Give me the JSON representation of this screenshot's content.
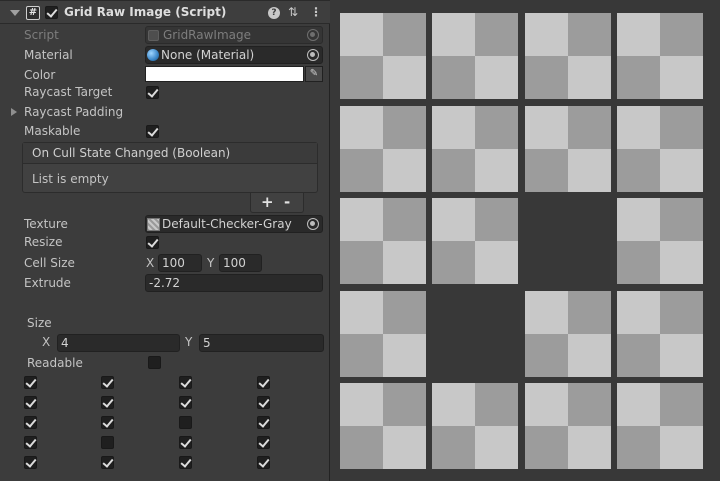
{
  "component": {
    "title": "Grid Raw Image (Script)",
    "enabled": true,
    "script_icon": "#",
    "header_icons": [
      "help-icon",
      "presets-icon",
      "kebab-menu-icon"
    ]
  },
  "fields": {
    "script": {
      "label": "Script",
      "value": "GridRawImage"
    },
    "material": {
      "label": "Material",
      "value": "None (Material)"
    },
    "color": {
      "label": "Color",
      "value": "#ffffff"
    },
    "raycast_target": {
      "label": "Raycast Target",
      "checked": true
    },
    "raycast_padding": {
      "label": "Raycast Padding"
    },
    "maskable": {
      "label": "Maskable",
      "checked": true
    },
    "texture": {
      "label": "Texture",
      "value": "Default-Checker-Gray"
    },
    "resize": {
      "label": "Resize",
      "checked": true
    },
    "cell_size": {
      "label": "Cell Size",
      "x_label": "X",
      "x": "100",
      "y_label": "Y",
      "y": "100"
    },
    "extrude": {
      "label": "Extrude",
      "value": "-2.72"
    }
  },
  "event": {
    "title": "On Cull State Changed (Boolean)",
    "empty_text": "List is empty",
    "add_label": "+",
    "remove_label": "-"
  },
  "grid": {
    "size_label": "Size",
    "x_label": "X",
    "x": "4",
    "y_label": "Y",
    "y": "5",
    "readable_label": "Readable",
    "readable": false,
    "cells": [
      [
        true,
        true,
        true,
        true
      ],
      [
        true,
        true,
        true,
        true
      ],
      [
        true,
        true,
        false,
        true
      ],
      [
        true,
        false,
        true,
        true
      ],
      [
        true,
        true,
        true,
        true
      ]
    ]
  },
  "preview": {
    "background": "#383838",
    "checker_light": "#c8c8c8",
    "checker_dark": "#9c9c9c"
  }
}
